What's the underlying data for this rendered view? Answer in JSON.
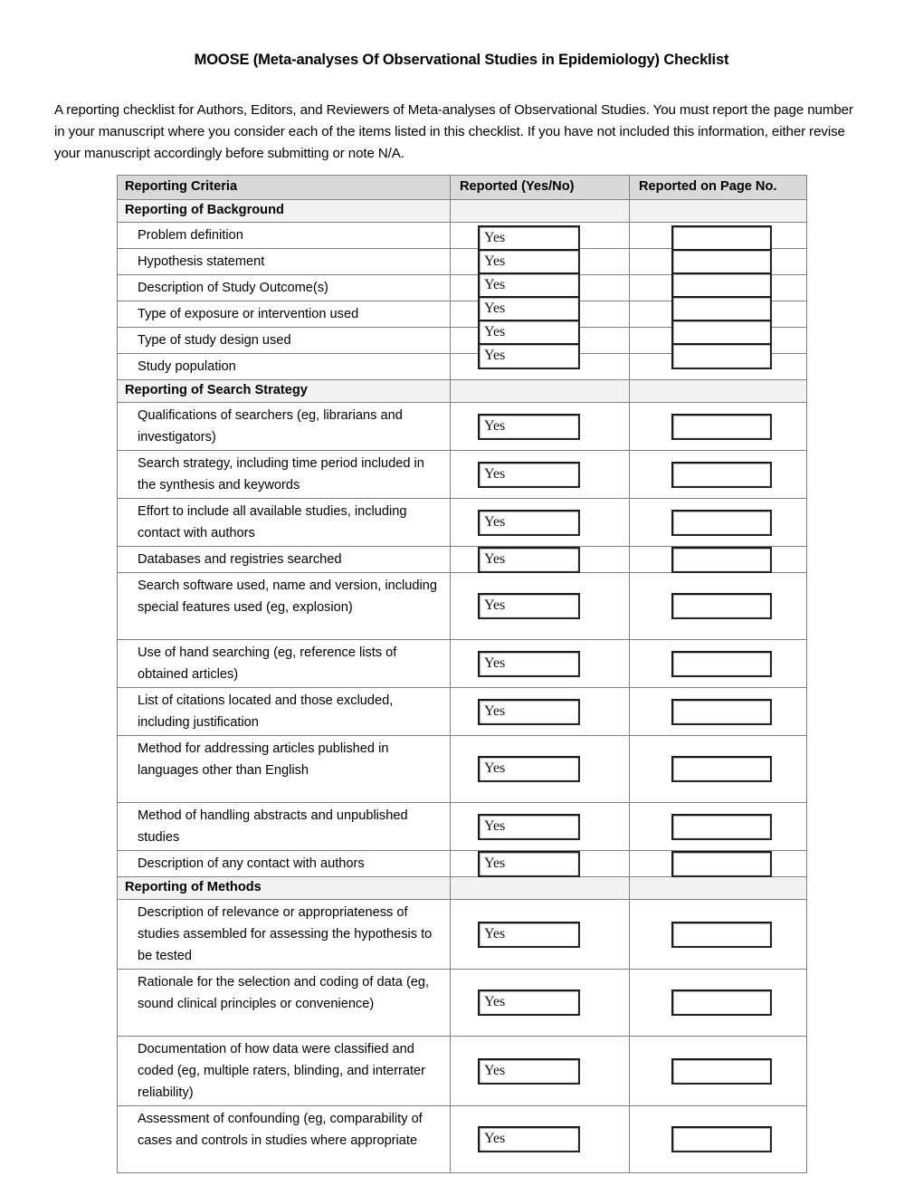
{
  "document": {
    "title": "MOOSE (Meta-analyses Of Observational Studies in Epidemiology) Checklist",
    "intro": "A reporting checklist for Authors, Editors, and Reviewers of Meta-analyses of Observational Studies. You must report the page number in your manuscript where you consider each of the items listed in this checklist. If you have not included this information, either revise your manuscript accordingly before submitting or note N/A."
  },
  "table": {
    "headers": {
      "criteria": "Reporting Criteria",
      "reported": "Reported (Yes/No)",
      "page": "Reported on Page No."
    },
    "sections": [
      {
        "title": "Reporting of Background",
        "items": [
          {
            "label": "Problem definition",
            "reported": "Yes",
            "page": ""
          },
          {
            "label": "Hypothesis statement",
            "reported": "Yes",
            "page": ""
          },
          {
            "label": "Description of Study Outcome(s)",
            "reported": "Yes",
            "page": ""
          },
          {
            "label": "Type of exposure or intervention used",
            "reported": "Yes",
            "page": ""
          },
          {
            "label": "Type of study design used",
            "reported": "Yes",
            "page": ""
          },
          {
            "label": "Study population",
            "reported": "Yes",
            "page": ""
          }
        ]
      },
      {
        "title": "Reporting of Search Strategy",
        "items": [
          {
            "label": "Qualifications of searchers (eg, librarians and investigators)",
            "reported": "Yes",
            "page": ""
          },
          {
            "label": "Search strategy, including time period included in the synthesis and keywords",
            "reported": "Yes",
            "page": ""
          },
          {
            "label": "Effort to include all available studies, including contact with authors",
            "reported": "Yes",
            "page": ""
          },
          {
            "label": "Databases and registries searched",
            "reported": "Yes",
            "page": ""
          },
          {
            "label": "Search software used, name and version, including special features used (eg, explosion)",
            "reported": "Yes",
            "page": ""
          },
          {
            "label": "Use of hand searching (eg, reference lists of obtained articles)",
            "reported": "Yes",
            "page": ""
          },
          {
            "label": "List of citations located and those excluded, including justification",
            "reported": "Yes",
            "page": ""
          },
          {
            "label": "Method for addressing articles published in languages other than English",
            "reported": "Yes",
            "page": ""
          },
          {
            "label": "Method of handling abstracts and unpublished studies",
            "reported": "Yes",
            "page": ""
          },
          {
            "label": "Description of any contact with authors",
            "reported": "Yes",
            "page": ""
          }
        ]
      },
      {
        "title": "Reporting of Methods",
        "items": [
          {
            "label": "Description of relevance or appropriateness of studies assembled for assessing the hypothesis to be tested",
            "reported": "Yes",
            "page": ""
          },
          {
            "label": "Rationale for the selection and coding of data (eg, sound clinical principles or convenience)",
            "reported": "Yes",
            "page": ""
          },
          {
            "label": "Documentation of how data were classified and coded (eg, multiple raters, blinding, and interrater reliability)",
            "reported": "Yes",
            "page": ""
          },
          {
            "label": "Assessment of confounding (eg, comparability of cases and controls in studies where appropriate",
            "reported": "Yes",
            "page": ""
          }
        ]
      }
    ]
  },
  "layout": {
    "row_heights": {
      "header": 27,
      "section": 25,
      "line": 24
    },
    "item_lines": [
      1,
      1,
      1,
      1,
      1,
      1,
      2,
      2,
      2,
      1,
      3,
      2,
      2,
      3,
      2,
      1,
      3,
      3,
      3,
      3
    ],
    "colors": {
      "header_bg": "#d9d9d9",
      "section_bg": "#f2f2f2",
      "grid": "#808080",
      "box_border": "#1a1a1a"
    }
  }
}
